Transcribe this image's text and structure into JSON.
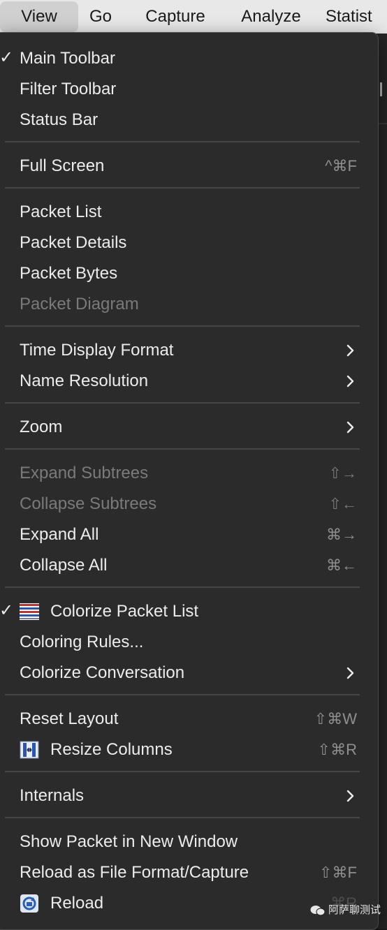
{
  "menubar": {
    "items": [
      "View",
      "Go",
      "Capture",
      "Analyze",
      "Statist"
    ],
    "active": "View"
  },
  "menu": {
    "main_toolbar": {
      "label": "Main Toolbar",
      "checked": true
    },
    "filter_toolbar": {
      "label": "Filter Toolbar"
    },
    "status_bar": {
      "label": "Status Bar"
    },
    "full_screen": {
      "label": "Full Screen",
      "shortcut": "^⌘F"
    },
    "packet_list": {
      "label": "Packet List"
    },
    "packet_details": {
      "label": "Packet Details"
    },
    "packet_bytes": {
      "label": "Packet Bytes"
    },
    "packet_diagram": {
      "label": "Packet Diagram",
      "disabled": true
    },
    "time_display_format": {
      "label": "Time Display Format",
      "submenu": true
    },
    "name_resolution": {
      "label": "Name Resolution",
      "submenu": true
    },
    "zoom": {
      "label": "Zoom",
      "submenu": true
    },
    "expand_subtrees": {
      "label": "Expand Subtrees",
      "shortcut": "⇧→",
      "disabled": true
    },
    "collapse_subtrees": {
      "label": "Collapse Subtrees",
      "shortcut": "⇧←",
      "disabled": true
    },
    "expand_all": {
      "label": "Expand All",
      "shortcut": "⌘→"
    },
    "collapse_all": {
      "label": "Collapse All",
      "shortcut": "⌘←"
    },
    "colorize_packet_list": {
      "label": "Colorize Packet List",
      "checked": true,
      "icon": "colorize-list-icon"
    },
    "coloring_rules": {
      "label": "Coloring Rules..."
    },
    "colorize_conversation": {
      "label": "Colorize Conversation",
      "submenu": true
    },
    "reset_layout": {
      "label": "Reset Layout",
      "shortcut": "⇧⌘W"
    },
    "resize_columns": {
      "label": "Resize Columns",
      "shortcut": "⇧⌘R",
      "icon": "resize-columns-icon"
    },
    "internals": {
      "label": "Internals",
      "submenu": true
    },
    "show_packet_new_window": {
      "label": "Show Packet in New Window"
    },
    "reload_as_file_format": {
      "label": "Reload as File Format/Capture",
      "shortcut": "⇧⌘F"
    },
    "reload": {
      "label": "Reload",
      "shortcut": "⌘R",
      "icon": "reload-icon"
    }
  },
  "check_glyph": "✓",
  "watermark": "阿萨聊测试",
  "colors": {
    "menu_bg": "#2b2b2b",
    "menubar_bg": "#e8e8e8",
    "text": "#ececec",
    "disabled_text": "#7a7a7a",
    "shortcut_text": "#8f8f8f"
  }
}
